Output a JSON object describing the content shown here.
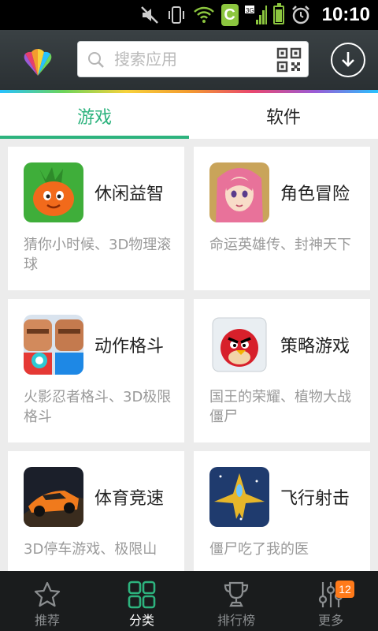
{
  "status_bar": {
    "time": "10:10",
    "app_badge": "C",
    "network": "3G"
  },
  "header": {
    "search_placeholder": "搜索应用"
  },
  "tabs": [
    {
      "label": "游戏",
      "active": true
    },
    {
      "label": "软件",
      "active": false
    }
  ],
  "categories": [
    {
      "title": "休闲益智",
      "desc": "猜你小时候、3D物理滚球",
      "icon": "carrot-game-icon"
    },
    {
      "title": "角色冒险",
      "desc": "命运英雄传、封神天下",
      "icon": "anime-girl-icon"
    },
    {
      "title": "动作格斗",
      "desc": "火影忍者格斗、3D极限格斗",
      "icon": "fighters-icon"
    },
    {
      "title": "策略游戏",
      "desc": "国王的荣耀、植物大战僵尸",
      "icon": "angry-bird-icon"
    },
    {
      "title": "体育竞速",
      "desc": "3D停车游戏、极限山",
      "icon": "race-car-icon"
    },
    {
      "title": "飞行射击",
      "desc": "僵尸吃了我的医",
      "icon": "fighter-jet-icon"
    }
  ],
  "bottom_nav": [
    {
      "label": "推荐",
      "icon": "star-icon",
      "active": false
    },
    {
      "label": "分类",
      "icon": "grid-icon",
      "active": true
    },
    {
      "label": "排行榜",
      "icon": "trophy-icon",
      "active": false
    },
    {
      "label": "更多",
      "icon": "sliders-icon",
      "active": false,
      "badge": "12"
    }
  ],
  "colors": {
    "accent": "#2db37e",
    "badge": "#ff7a1a"
  }
}
